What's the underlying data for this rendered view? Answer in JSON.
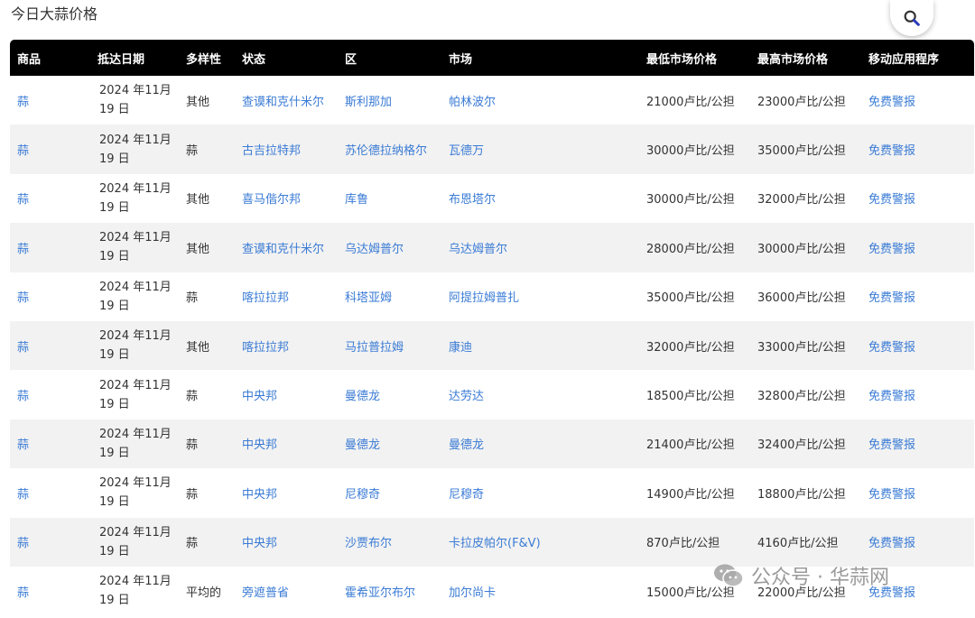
{
  "page": {
    "title": "今日大蒜价格"
  },
  "table": {
    "headers": [
      "商品",
      "抵达日期",
      "多样性",
      "状态",
      "区",
      "市场",
      "最低市场价格",
      "最高市场价格",
      "移动应用程序"
    ],
    "rows": [
      {
        "commodity": "蒜",
        "date": "2024 年11月 19 日",
        "variety": "其他",
        "state": "查谟和克什米尔",
        "district": "斯利那加",
        "market": "帕林波尔",
        "min": "21000卢比/公担",
        "max": "23000卢比/公担",
        "app": "免费警报"
      },
      {
        "commodity": "蒜",
        "date": "2024 年11月 19 日",
        "variety": "蒜",
        "state": "古吉拉特邦",
        "district": "苏伦德拉纳格尔",
        "market": "瓦德万",
        "min": "30000卢比/公担",
        "max": "35000卢比/公担",
        "app": "免费警报"
      },
      {
        "commodity": "蒜",
        "date": "2024 年11月 19 日",
        "variety": "其他",
        "state": "喜马偕尔邦",
        "district": "库鲁",
        "market": "布恩塔尔",
        "min": "30000卢比/公担",
        "max": "32000卢比/公担",
        "app": "免费警报"
      },
      {
        "commodity": "蒜",
        "date": "2024 年11月 19 日",
        "variety": "其他",
        "state": "查谟和克什米尔",
        "district": "乌达姆普尔",
        "market": "乌达姆普尔",
        "min": "28000卢比/公担",
        "max": "30000卢比/公担",
        "app": "免费警报"
      },
      {
        "commodity": "蒜",
        "date": "2024 年11月 19 日",
        "variety": "蒜",
        "state": "喀拉拉邦",
        "district": "科塔亚姆",
        "market": "阿提拉姆普扎",
        "min": "35000卢比/公担",
        "max": "36000卢比/公担",
        "app": "免费警报"
      },
      {
        "commodity": "蒜",
        "date": "2024 年11月 19 日",
        "variety": "其他",
        "state": "喀拉拉邦",
        "district": "马拉普拉姆",
        "market": "康迪",
        "min": "32000卢比/公担",
        "max": "33000卢比/公担",
        "app": "免费警报"
      },
      {
        "commodity": "蒜",
        "date": "2024 年11月 19 日",
        "variety": "蒜",
        "state": "中央邦",
        "district": "曼德龙",
        "market": "达劳达",
        "min": "18500卢比/公担",
        "max": "32800卢比/公担",
        "app": "免费警报"
      },
      {
        "commodity": "蒜",
        "date": "2024 年11月 19 日",
        "variety": "蒜",
        "state": "中央邦",
        "district": "曼德龙",
        "market": "曼德龙",
        "min": "21400卢比/公担",
        "max": "32400卢比/公担",
        "app": "免费警报"
      },
      {
        "commodity": "蒜",
        "date": "2024 年11月 19 日",
        "variety": "蒜",
        "state": "中央邦",
        "district": "尼穆奇",
        "market": "尼穆奇",
        "min": "14900卢比/公担",
        "max": "18800卢比/公担",
        "app": "免费警报"
      },
      {
        "commodity": "蒜",
        "date": "2024 年11月 19 日",
        "variety": "蒜",
        "state": "中央邦",
        "district": "沙贾布尔",
        "market": "卡拉皮帕尔(F&V)",
        "min": "870卢比/公担",
        "max": "4160卢比/公担",
        "app": "免费警报"
      },
      {
        "commodity": "蒜",
        "date": "2024 年11月 19 日",
        "variety": "平均的",
        "state": "旁遮普省",
        "district": "霍希亚尔布尔",
        "market": "加尔尚卡",
        "min": "15000卢比/公担",
        "max": "22000卢比/公担",
        "app": "免费警报"
      }
    ]
  },
  "watermark": {
    "text": "公众号 · 华蒜网"
  },
  "icons": {
    "search": "search-icon",
    "watermark": "wechat-icon"
  },
  "colors": {
    "header_bg": "#000000",
    "link": "#3a7bd5",
    "stripe": "#f2f2f2",
    "search_handle": "#2a3bb8"
  }
}
